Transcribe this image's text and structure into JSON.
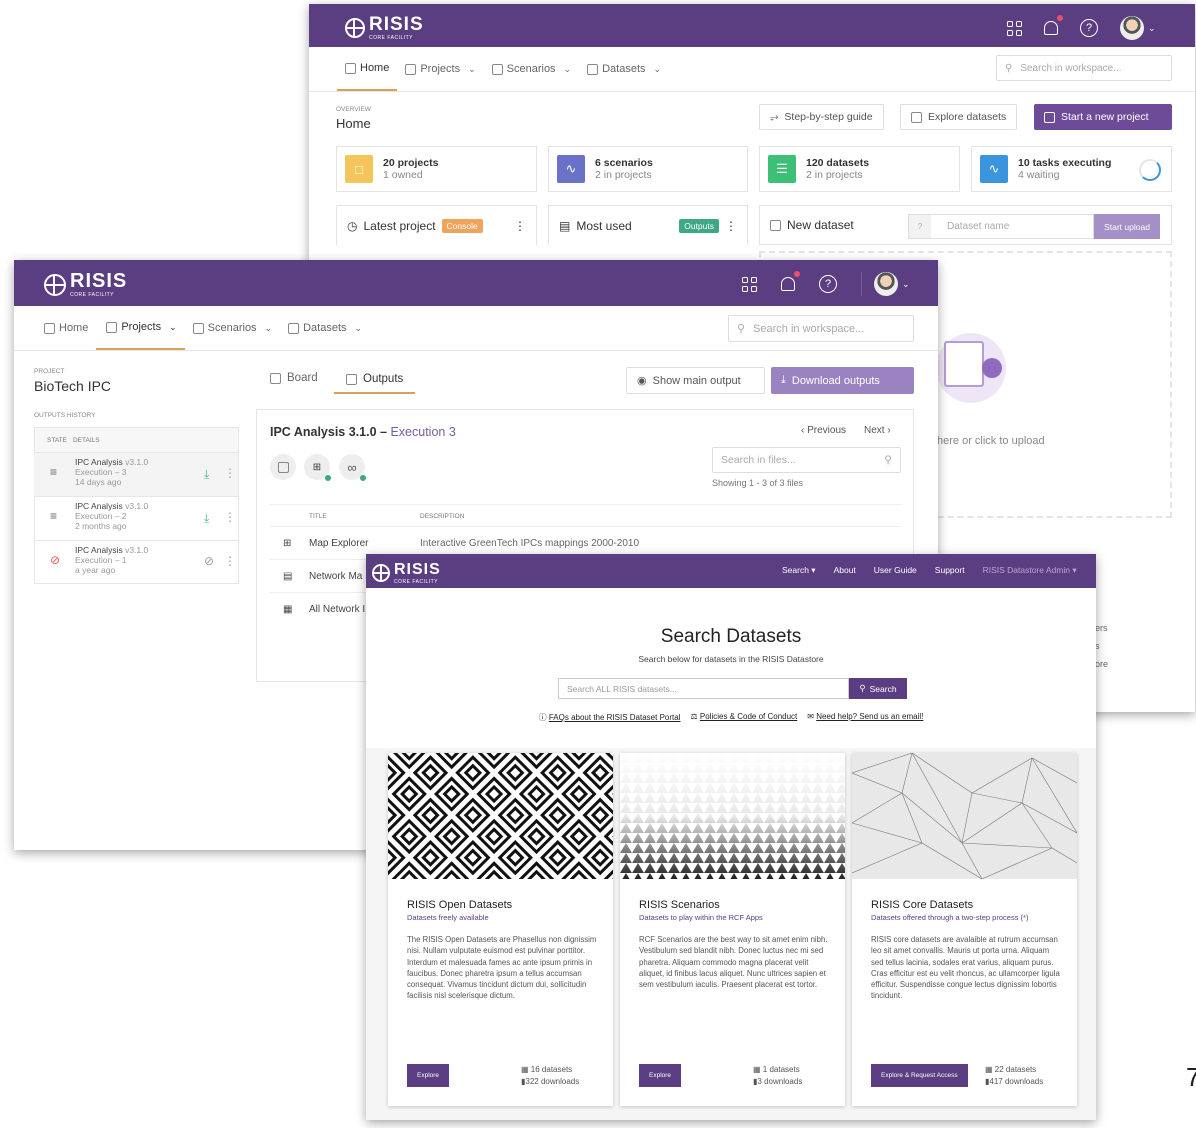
{
  "brand": {
    "name": "RISIS",
    "sub": "CORE FACILITY"
  },
  "nav": {
    "home": "Home",
    "projects": "Projects",
    "scenarios": "Scenarios",
    "datasets": "Datasets",
    "search_placeholder": "Search in workspace..."
  },
  "dashboard": {
    "overview_label": "OVERVIEW",
    "title": "Home",
    "btn_guide": "Step-by-step guide",
    "btn_explore": "Explore datasets",
    "btn_new_project": "Start a new project",
    "stats": [
      {
        "title": "20 projects",
        "sub": "1 owned",
        "color": "#f3c55b"
      },
      {
        "title": "6 scenarios",
        "sub": "2 in projects",
        "color": "#6a72c8"
      },
      {
        "title": "120 datasets",
        "sub": "2 in projects",
        "color": "#3dbf78"
      },
      {
        "title": "10 tasks executing",
        "sub": "4 waiting",
        "color": "#3a95dd"
      }
    ],
    "latest_project": "Latest project",
    "console_tag": "Console",
    "most_used": "Most used",
    "outputs_tag": "Outputs",
    "new_dataset": "New dataset",
    "dataset_name_placeholder": "Dataset name",
    "start_upload": "Start upload",
    "upload_hint": "here or click to upload",
    "partial_links": [
      "ers",
      "s",
      "ore"
    ]
  },
  "project": {
    "label": "PROJECT",
    "name": "BioTech IPC",
    "history_label": "OUTPUTS HISTORY",
    "col_state": "STATE",
    "col_details": "DETAILS",
    "history": [
      {
        "name": "IPC Analysis",
        "ver": "v3.1.0",
        "exec": "Execution – 3",
        "age": "14 days ago"
      },
      {
        "name": "IPC Analysis",
        "ver": "v3.1.0",
        "exec": "Execution – 2",
        "age": "2 months ago"
      },
      {
        "name": "IPC Analysis",
        "ver": "v3.1.0",
        "exec": "Execution – 1",
        "age": "a year ago"
      }
    ],
    "tab_board": "Board",
    "tab_outputs": "Outputs",
    "btn_show_main": "Show main output",
    "btn_download": "Download outputs",
    "analysis_title": "IPC Analysis 3.1.0 –",
    "execution": "Execution 3",
    "previous": "Previous",
    "next": "Next",
    "search_files_placeholder": "Search in files...",
    "showing": "Showing 1 - 3 of 3 files",
    "col_title": "TITLE",
    "col_desc": "DESCRIPTION",
    "files": [
      {
        "title": "Map Explorer",
        "desc": "Interactive GreenTech IPCs mappings 2000-2010"
      },
      {
        "title": "Network Ma",
        "desc": ""
      },
      {
        "title": "All Network I",
        "desc": ""
      }
    ]
  },
  "datastore": {
    "menu": {
      "search": "Search",
      "about": "About",
      "guide": "User Guide",
      "support": "Support",
      "admin": "RISIS Datastore Admin"
    },
    "title": "Search Datasets",
    "subtitle": "Search below for datasets in the RISIS Datastore",
    "search_placeholder": "Search ALL RISIS datasets...",
    "search_btn": "Search",
    "links": {
      "faq": "FAQs about the RISIS Dataset Portal",
      "policies": "Policies & Code of Conduct",
      "help": "Need help? Send us an email!"
    },
    "cards": [
      {
        "title": "RISIS Open Datasets",
        "subtitle": "Datasets freely available",
        "text": "The RISIS Open Datasets are Phasellus non dignissim nisi. Nullam vulputate euismod est pulvinar porttitor. Interdum et malesuada fames ac ante ipsum primis in faucibus. Donec pharetra ipsum a tellus accumsan consequat. Vivamus tincidunt dictum dui, sollicitudin facilisis nisl scelerisque dictum.",
        "button": "Explore",
        "datasets": "16 datasets",
        "downloads": "322 downloads"
      },
      {
        "title": "RISIS Scenarios",
        "subtitle": "Datasets to play within the RCF Apps",
        "text": "RCF Scenarios are the best way to sit amet enim nibh. Vestibulum sed blandit nibh. Donec luctus nec mi sed pharetra. Aliquam commodo magna placerat velit aliquet, id finibus lacus aliquet. Nunc ultrices sapien et sem vestibulum iaculis. Praesent placerat est tortor.",
        "button": "Explore",
        "datasets": "1 datasets",
        "downloads": "3 downloads"
      },
      {
        "title": "RISIS Core Datasets",
        "subtitle": "Datasets offered through a two-step process (*)",
        "text": "RISIS core datasets are avalaible at rutrum accumsan leo sit amet convallis. Mauris ut porta urna. Aliquam sed tellus lacinia, sodales erat varius, aliquam purus. Cras efficitur est eu velit rhoncus, ac ullamcorper ligula efficitur. Suspendisse congue lectus dignissim lobortis tincidunt.",
        "button": "Explore & Request Access",
        "datasets": "22 datasets",
        "downloads": "417 downloads"
      }
    ]
  },
  "page_number": "7"
}
